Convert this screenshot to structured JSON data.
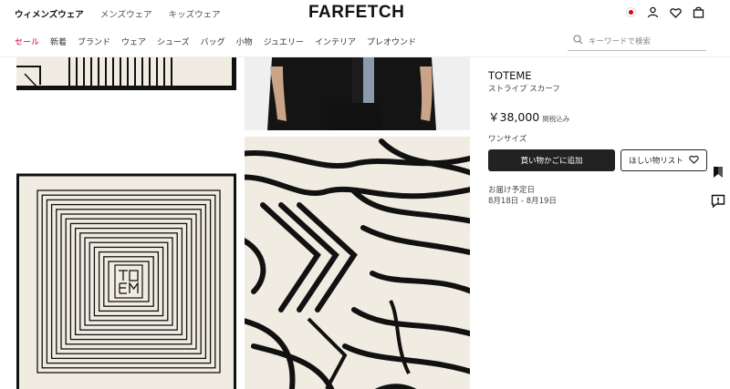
{
  "header": {
    "gender_tabs": [
      "ウィメンズウェア",
      "メンズウェア",
      "キッズウェア"
    ],
    "logo": "FARFETCH",
    "icons": [
      "flag-japan-icon",
      "user-icon",
      "heart-icon",
      "bag-icon"
    ]
  },
  "categories": [
    "セール",
    "新着",
    "ブランド",
    "ウェア",
    "シューズ",
    "バッグ",
    "小物",
    "ジュエリー",
    "インテリア",
    "プレオウンド"
  ],
  "search": {
    "placeholder": "キーワードで検索"
  },
  "product": {
    "brand": "TOTEME",
    "name": "ストライプ スカーフ",
    "price": "￥38,000",
    "tax_note": "関税込み",
    "size": "ワンサイズ",
    "add_to_bag": "買い物かごに追加",
    "wishlist": "ほしい物リスト",
    "delivery_label": "お届け予定日",
    "delivery_date": "8月18日 - 8月19日"
  },
  "colors": {
    "sale": "#d6002a",
    "primary": "#222222",
    "scarf_bg": "#f1ece1"
  },
  "side_icons": [
    "bookmark-icon",
    "feedback-icon"
  ]
}
